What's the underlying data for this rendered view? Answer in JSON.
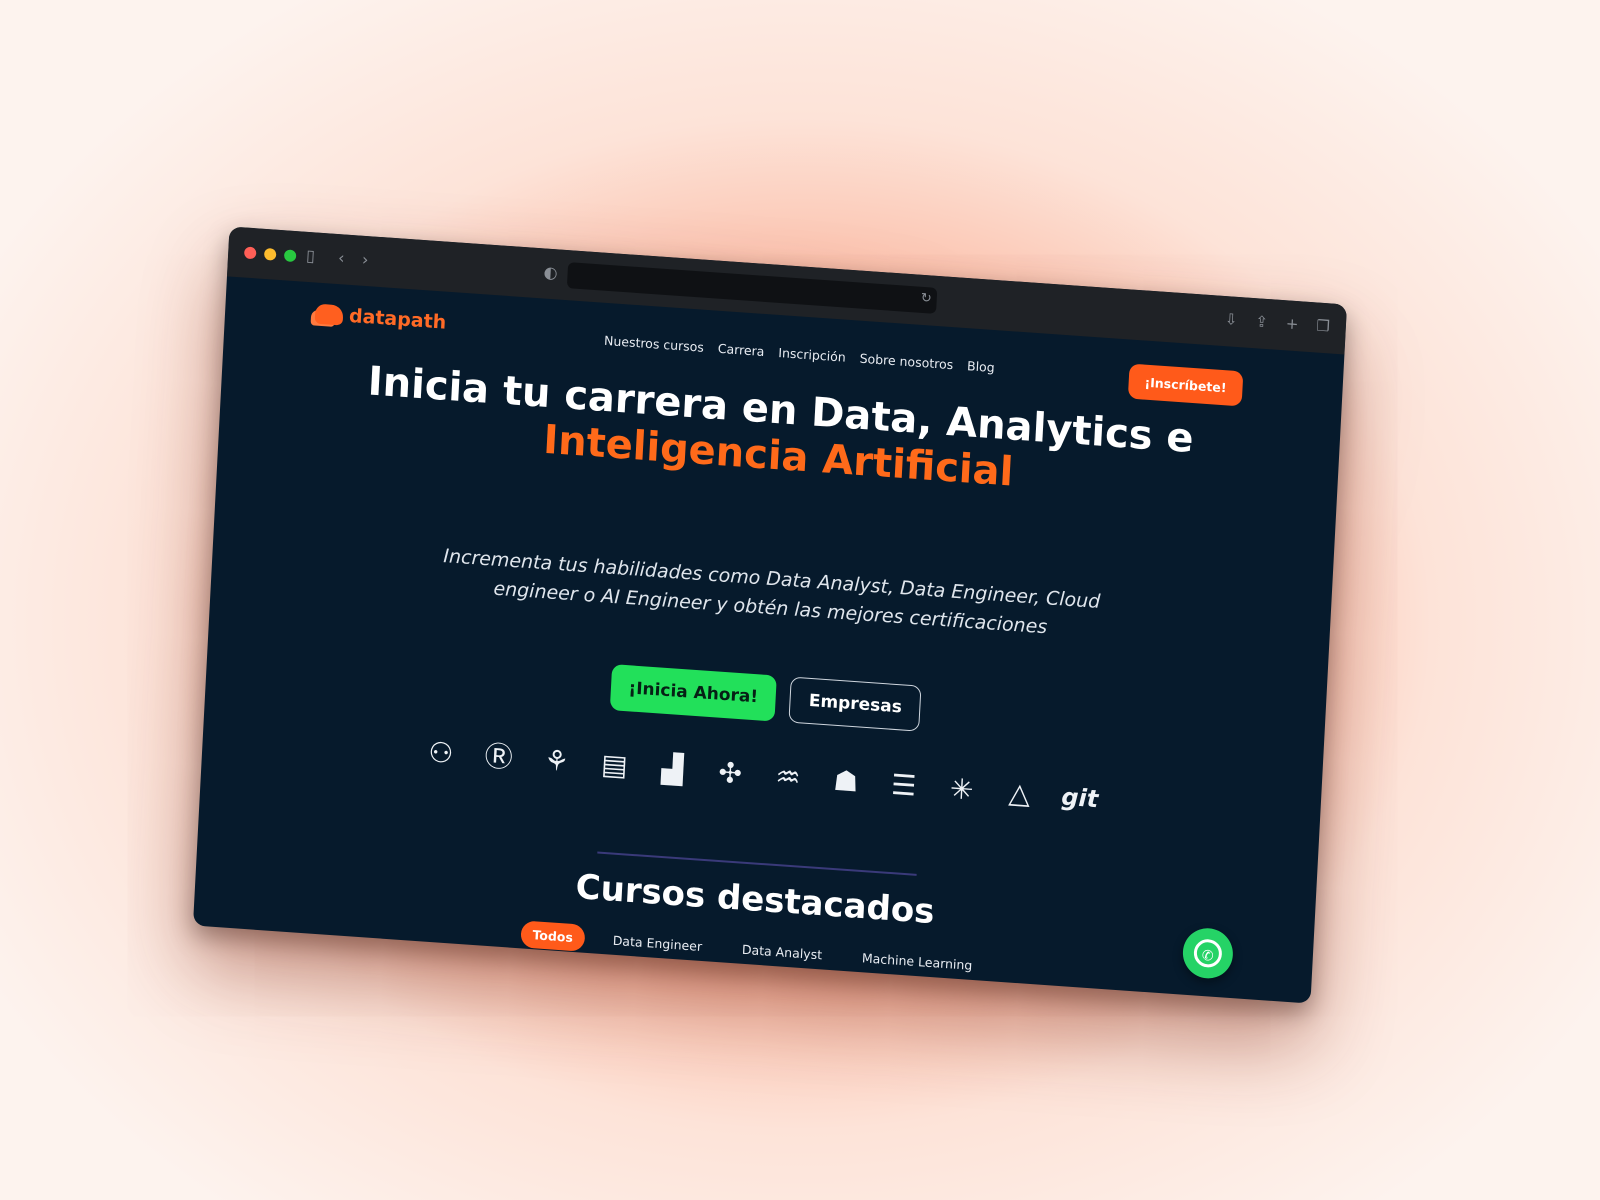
{
  "chrome": {
    "sidebar_icon": "sidebar-icon",
    "back_icon": "chevron-left-icon",
    "forward_icon": "chevron-right-icon",
    "shield_icon": "shield-icon",
    "reload_icon": "reload-icon",
    "download_icon": "download-icon",
    "share_icon": "share-icon",
    "new_tab_icon": "plus-icon",
    "tabs_icon": "tabs-icon",
    "dot_colors": [
      "#ff5f57",
      "#febc2e",
      "#28c840"
    ]
  },
  "logo": {
    "text": "datapath"
  },
  "nav": {
    "items": [
      "Nuestros cursos",
      "Carrera",
      "Inscripción",
      "Sobre nosotros",
      "Blog"
    ]
  },
  "cta_top": "¡Inscríbete!",
  "hero": {
    "title_line1": "Inicia tu carrera en Data, Analytics e",
    "title_line2": "Inteligencia Artificial",
    "subtitle": "Incrementa tus habilidades como Data Analyst, Data Engineer, Cloud engineer o AI Engineer y obtén las mejores certificaciones",
    "primary_button": "¡Inicia Ahora!",
    "secondary_button": "Empresas"
  },
  "tools": {
    "icons": [
      "python-icon",
      "r-icon",
      "hive-icon",
      "bi-report-icon",
      "power-bi-icon",
      "tableau-icon",
      "mysql-icon",
      "docker-icon",
      "layers-icon",
      "snowflake-icon",
      "azure-icon"
    ],
    "git_label": "git"
  },
  "courses": {
    "title": "Cursos destacados",
    "filters": [
      "Todos",
      "Data Engineer",
      "Data Analyst",
      "Machine Learning"
    ]
  },
  "colors": {
    "accent": "#ff5a1a",
    "green": "#22e05a",
    "background": "#061a2c"
  }
}
